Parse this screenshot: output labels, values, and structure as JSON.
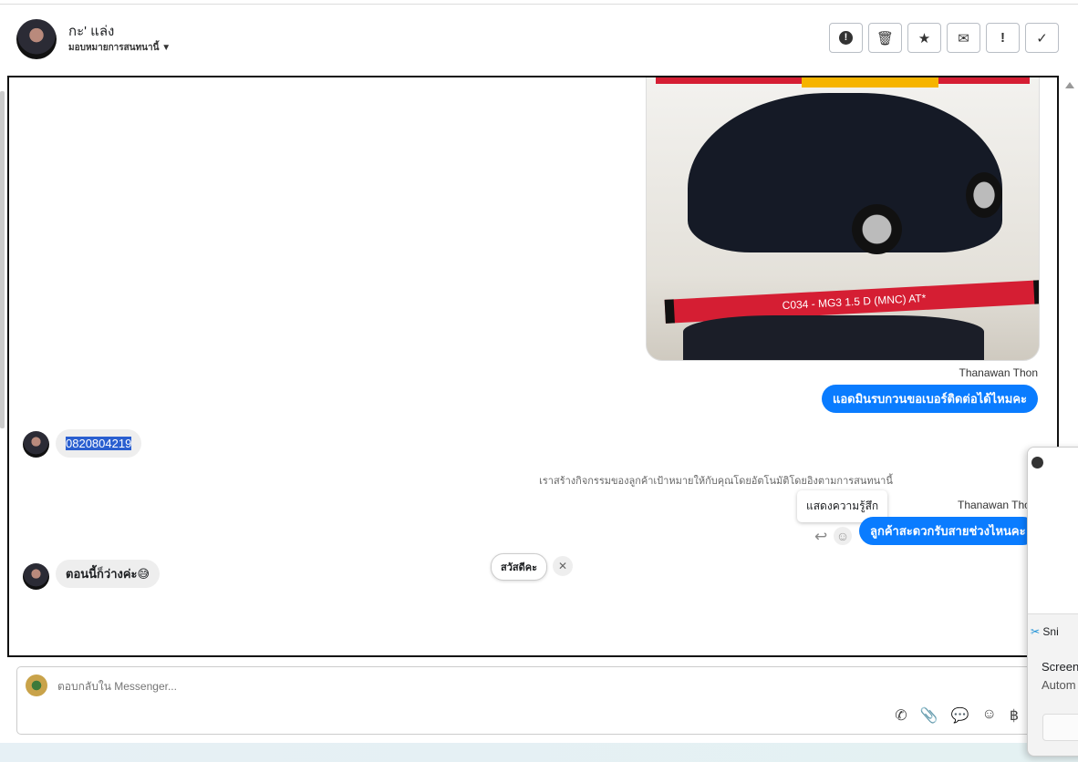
{
  "header": {
    "contact_name": "กะ' แล่ง",
    "assign_label": "มอบหมายการสนทนานี้"
  },
  "actions": [
    {
      "name": "spam",
      "glyph": "⬤"
    },
    {
      "name": "delete",
      "glyph": "🗑"
    },
    {
      "name": "star",
      "glyph": "★"
    },
    {
      "name": "mark-unread",
      "glyph": "✉"
    },
    {
      "name": "important",
      "glyph": "!"
    },
    {
      "name": "done",
      "glyph": "✓"
    }
  ],
  "chat": {
    "image_caption": "C034 - MG3 1.5 D (MNC) AT*",
    "messages": [
      {
        "sender": "Thanawan Thon",
        "text": "แอดมินรบกวนขอเบอร์ติดต่อได้ไหมคะ"
      },
      {
        "text": "0820804219"
      },
      {
        "system": "เราสร้างกิจกรรมของลูกค้าเป้าหมายให้กับคุณโดยอัตโนมัติโดยอิงตามการสนทนานี้"
      },
      {
        "sender": "Thanawan Thon",
        "text": "ลูกค้าสะดวกรับสายช่วงไหนคะ"
      },
      {
        "text": "ตอนนี้ก็ว่างค่ะ😅"
      }
    ],
    "tooltip": "แสดงความรู้สึก",
    "quick_reply": "สวัสดีคะ",
    "quick_close": "✕"
  },
  "composer": {
    "placeholder": "ตอบกลับใน Messenger...",
    "currency_glyph": "฿"
  },
  "snip": {
    "app": "Sni",
    "line1": "Screen",
    "line2": "Autom"
  }
}
